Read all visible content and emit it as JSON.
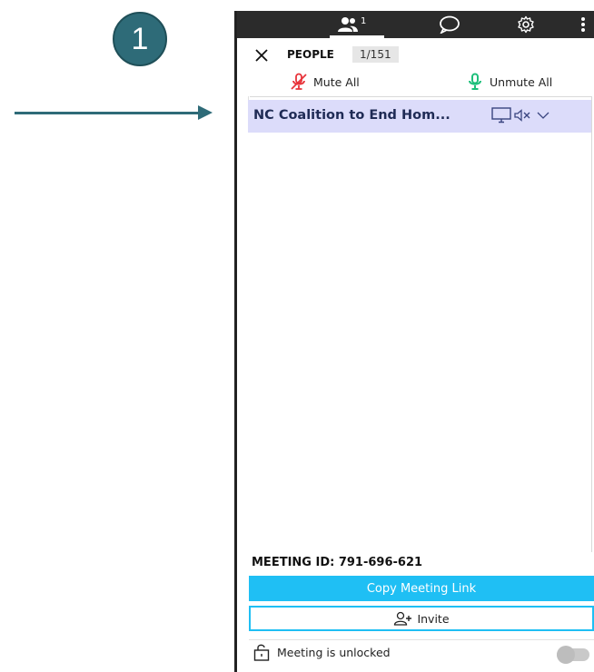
{
  "step_number": "1",
  "topbar": {
    "people_count": "1",
    "tabs": [
      "people-tab",
      "chat-tab",
      "settings-tab",
      "more-tab"
    ]
  },
  "panel": {
    "title": "PEOPLE",
    "count_badge": "1/151",
    "mute_all_label": "Mute All",
    "unmute_all_label": "Unmute All"
  },
  "participants": [
    {
      "name": "NC Coalition to End Hom..."
    }
  ],
  "footer": {
    "meeting_id": "MEETING ID: 791-696-621",
    "copy_link_label": "Copy Meeting Link",
    "invite_label": "Invite",
    "lock_status": "Meeting is unlocked"
  },
  "colors": {
    "accent": "#1fbff4",
    "step_badge": "#2e6b78",
    "selected_row": "#dcdcfa",
    "mute_red": "#e8333a",
    "unmute_green": "#1dbf7a",
    "topbar": "#2b2b2b"
  }
}
